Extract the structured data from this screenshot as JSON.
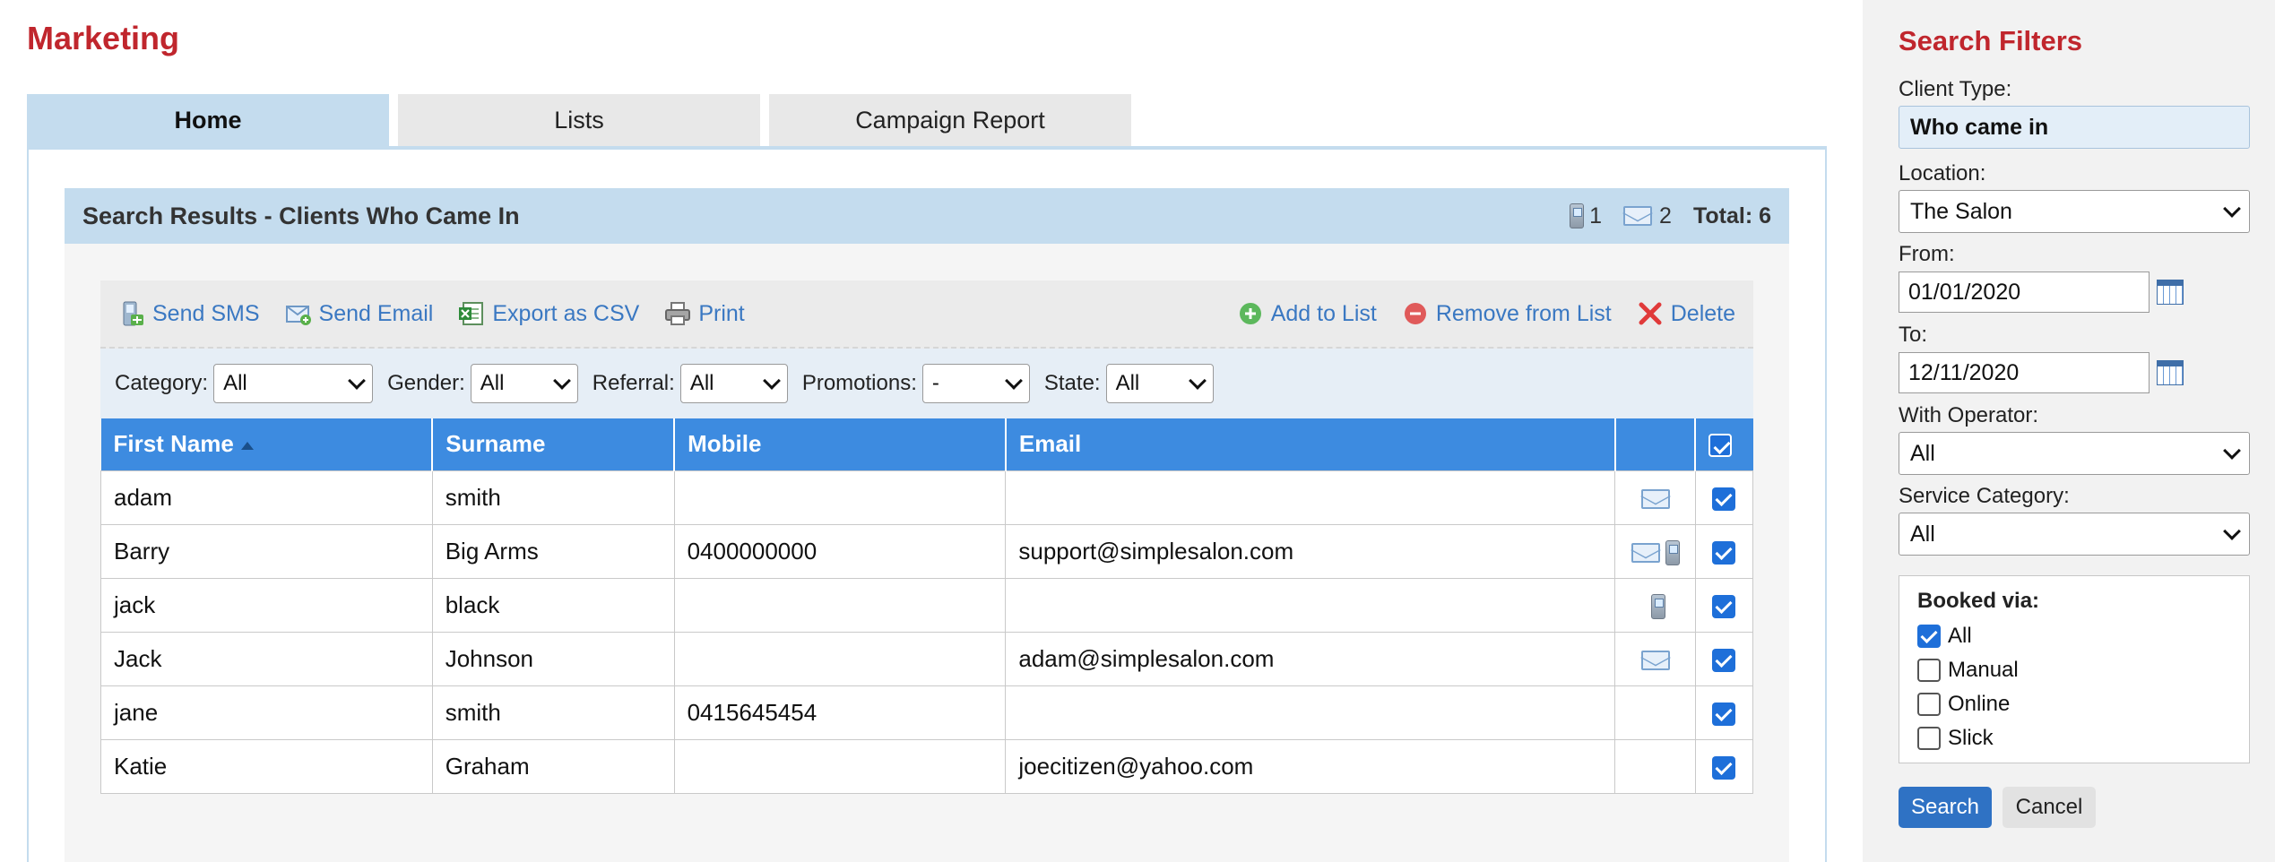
{
  "page_title": "Marketing",
  "tabs": [
    {
      "label": "Home",
      "active": true
    },
    {
      "label": "Lists",
      "active": false
    },
    {
      "label": "Campaign Report",
      "active": false
    }
  ],
  "results": {
    "title": "Search Results - Clients Who Came In",
    "sms_count": "1",
    "email_count": "2",
    "total_label": "Total: 6"
  },
  "toolbar": {
    "send_sms": "Send SMS",
    "send_email": "Send Email",
    "export_csv": "Export as CSV",
    "print": "Print",
    "add_to_list": "Add to List",
    "remove_from_list": "Remove from List",
    "delete": "Delete"
  },
  "filters": {
    "category_label": "Category:",
    "category_value": "All",
    "gender_label": "Gender:",
    "gender_value": "All",
    "referral_label": "Referral:",
    "referral_value": "All",
    "promotions_label": "Promotions:",
    "promotions_value": "-",
    "state_label": "State:",
    "state_value": "All"
  },
  "table": {
    "columns": [
      "First Name",
      "Surname",
      "Mobile",
      "Email"
    ],
    "rows": [
      {
        "first": "adam",
        "surname": "smith",
        "mobile": "",
        "email": "",
        "has_email": true,
        "has_sms": false,
        "selected": true
      },
      {
        "first": "Barry",
        "surname": "Big Arms",
        "mobile": "0400000000",
        "email": "support@simplesalon.com",
        "has_email": true,
        "has_sms": true,
        "selected": true
      },
      {
        "first": "jack",
        "surname": "black",
        "mobile": "",
        "email": "",
        "has_email": false,
        "has_sms": true,
        "selected": true
      },
      {
        "first": "Jack",
        "surname": "Johnson",
        "mobile": "",
        "email": "adam@simplesalon.com",
        "has_email": true,
        "has_sms": false,
        "selected": true
      },
      {
        "first": "jane",
        "surname": "smith",
        "mobile": "0415645454",
        "email": "",
        "has_email": false,
        "has_sms": false,
        "selected": true
      },
      {
        "first": "Katie",
        "surname": "Graham",
        "mobile": "",
        "email": "joecitizen@yahoo.com",
        "has_email": false,
        "has_sms": false,
        "selected": true
      }
    ]
  },
  "sidebar": {
    "title": "Search Filters",
    "client_type_label": "Client Type:",
    "client_type_value": "Who came in",
    "location_label": "Location:",
    "location_value": "The Salon",
    "from_label": "From:",
    "from_value": "01/01/2020",
    "to_label": "To:",
    "to_value": "12/11/2020",
    "operator_label": "With Operator:",
    "operator_value": "All",
    "service_label": "Service Category:",
    "service_value": "All",
    "booked_via_title": "Booked via:",
    "booked_via": [
      {
        "label": "All",
        "checked": true
      },
      {
        "label": "Manual",
        "checked": false
      },
      {
        "label": "Online",
        "checked": false
      },
      {
        "label": "Slick",
        "checked": false
      }
    ],
    "search_button": "Search",
    "cancel_button": "Cancel"
  },
  "colors": {
    "brand_red": "#c0262d",
    "header_blue": "#3d8be0",
    "panel_blue": "#c4dcee",
    "link_blue": "#3a78c2"
  }
}
